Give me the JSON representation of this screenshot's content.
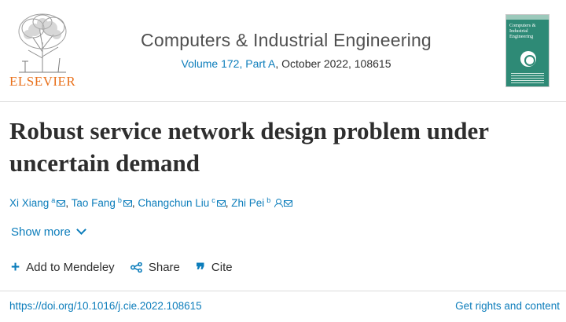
{
  "publisher": {
    "name": "ELSEVIER",
    "logo_icon": "elsevier-tree-icon"
  },
  "journal": {
    "title": "Computers & Industrial Engineering",
    "volume_link": "Volume 172, Part A",
    "issue_suffix": ", October 2022, 108615",
    "cover_title": "Computers & Industrial Engineering"
  },
  "article": {
    "title": "Robust service network design problem under uncertain demand",
    "authors": [
      {
        "name": "Xi Xiang",
        "sup": "a"
      },
      {
        "name": "Tao Fang",
        "sup": "b"
      },
      {
        "name": "Changchun Liu",
        "sup": "c"
      },
      {
        "name": "Zhi Pei",
        "sup": "b"
      }
    ],
    "separator": ", "
  },
  "controls": {
    "show_more": "Show more",
    "add_mendeley": "Add to Mendeley",
    "share": "Share",
    "cite": "Cite"
  },
  "footer": {
    "doi": "https://doi.org/10.1016/j.cie.2022.108615",
    "rights": "Get rights and content"
  },
  "colors": {
    "link": "#0c7dbb",
    "text": "#2e2e2e",
    "brand_orange": "#e9711c",
    "cover_green": "#2e8a76"
  }
}
